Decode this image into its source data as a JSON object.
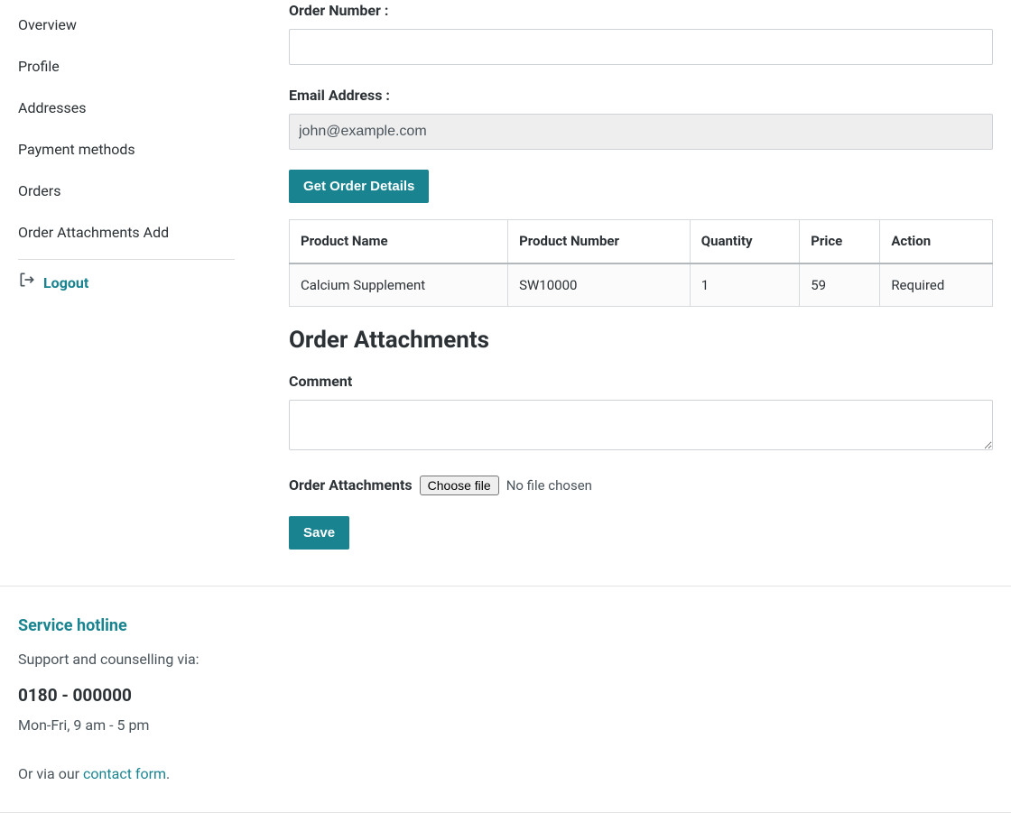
{
  "sidebar": {
    "items": [
      {
        "label": "Overview"
      },
      {
        "label": "Profile"
      },
      {
        "label": "Addresses"
      },
      {
        "label": "Payment methods"
      },
      {
        "label": "Orders"
      },
      {
        "label": "Order Attachments Add"
      }
    ],
    "logout_label": "Logout"
  },
  "form": {
    "order_number_label": "Order Number :",
    "order_number_value": "",
    "email_label": "Email Address :",
    "email_value": "john@example.com",
    "get_order_details_label": "Get Order Details"
  },
  "table": {
    "headers": {
      "product_name": "Product Name",
      "product_number": "Product Number",
      "quantity": "Quantity",
      "price": "Price",
      "action": "Action"
    },
    "rows": [
      {
        "product_name": "Calcium Supplement",
        "product_number": "SW10000",
        "quantity": "1",
        "price": "59",
        "action": "Required"
      }
    ]
  },
  "attachments": {
    "heading": "Order Attachments",
    "comment_label": "Comment",
    "comment_value": "",
    "file_label": "Order Attachments",
    "choose_file_label": "Choose file",
    "no_file_text": "No file chosen",
    "save_label": "Save"
  },
  "footer": {
    "heading": "Service hotline",
    "support_line": "Support and counselling via:",
    "phone": "0180 - 000000",
    "hours": "Mon-Fri, 9 am - 5 pm",
    "via_prefix": "Or via our ",
    "contact_link": "contact form",
    "via_suffix": "."
  }
}
